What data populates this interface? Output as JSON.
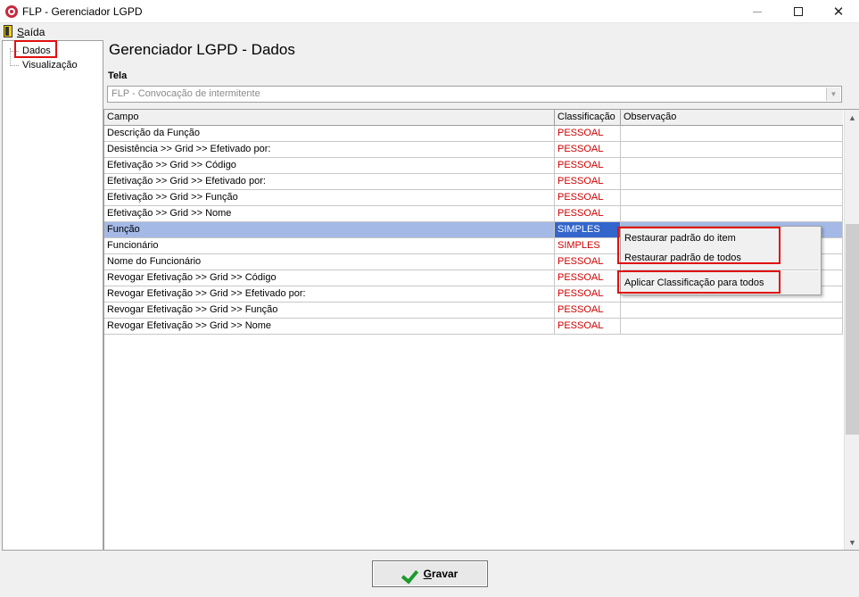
{
  "window": {
    "title": "FLP - Gerenciador LGPD",
    "minimize_icon": "minimize-icon",
    "maximize_icon": "maximize-icon",
    "close_icon": "close-icon",
    "close_glyph": "✕"
  },
  "menu": {
    "exit_first": "S",
    "exit_rest": "aída"
  },
  "tree": {
    "items": [
      {
        "label": "Dados",
        "selected": true
      },
      {
        "label": "Visualização",
        "selected": false
      }
    ]
  },
  "main": {
    "title": "Gerenciador LGPD - Dados",
    "tela_label": "Tela",
    "tela_value": "FLP - Convocação de intermitente",
    "combo_arrow": "▼"
  },
  "grid": {
    "columns": [
      "Campo",
      "Classificação",
      "Observação"
    ],
    "rows": [
      {
        "campo": "Descrição da Função",
        "classificacao": "PESSOAL",
        "observacao": ""
      },
      {
        "campo": "Desistência >> Grid >> Efetivado por:",
        "classificacao": "PESSOAL",
        "observacao": ""
      },
      {
        "campo": "Efetivação >> Grid >> Código",
        "classificacao": "PESSOAL",
        "observacao": ""
      },
      {
        "campo": "Efetivação >> Grid >> Efetivado por:",
        "classificacao": "PESSOAL",
        "observacao": ""
      },
      {
        "campo": "Efetivação >> Grid >> Função",
        "classificacao": "PESSOAL",
        "observacao": ""
      },
      {
        "campo": "Efetivação >> Grid >> Nome",
        "classificacao": "PESSOAL",
        "observacao": ""
      },
      {
        "campo": "Função",
        "classificacao": "SIMPLES",
        "observacao": "",
        "selected": true
      },
      {
        "campo": "Funcionário",
        "classificacao": "SIMPLES",
        "observacao": ""
      },
      {
        "campo": "Nome do Funcionário",
        "classificacao": "PESSOAL",
        "observacao": ""
      },
      {
        "campo": "Revogar Efetivação >> Grid >> Código",
        "classificacao": "PESSOAL",
        "observacao": ""
      },
      {
        "campo": "Revogar Efetivação >> Grid >> Efetivado por:",
        "classificacao": "PESSOAL",
        "observacao": ""
      },
      {
        "campo": "Revogar Efetivação >> Grid >> Função",
        "classificacao": "PESSOAL",
        "observacao": ""
      },
      {
        "campo": "Revogar Efetivação >> Grid >> Nome",
        "classificacao": "PESSOAL",
        "observacao": ""
      }
    ],
    "scroll_up": "▲",
    "scroll_down": "▼"
  },
  "context_menu": {
    "items": [
      "Restaurar padrão do item",
      "Restaurar padrão de todos",
      "Aplicar Classificação para todos"
    ]
  },
  "footer": {
    "save_first": "G",
    "save_rest": "ravar"
  },
  "colors": {
    "highlight_box": "#e01010",
    "classification_text": "#d00000",
    "selected_row": "#a4b9e6",
    "selected_cell": "#3366cc",
    "save_check": "#1b9a2a"
  }
}
